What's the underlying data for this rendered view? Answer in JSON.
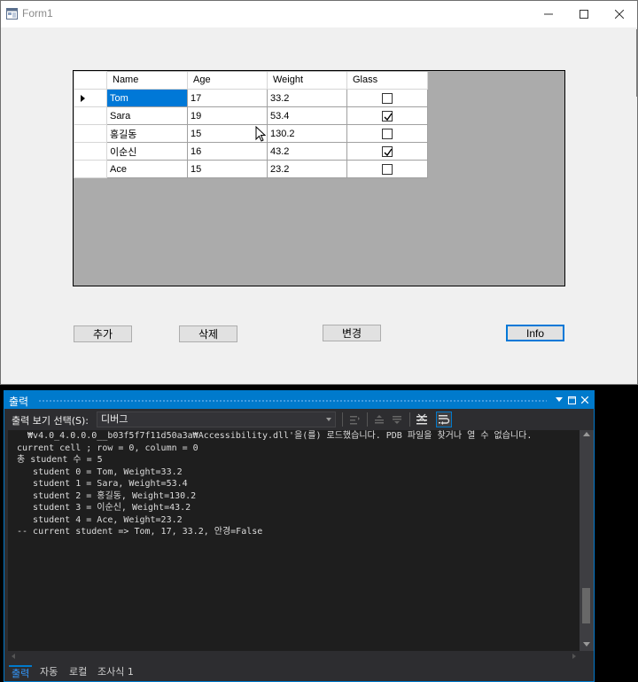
{
  "form": {
    "title": "Form1",
    "columns": [
      "Name",
      "Age",
      "Weight",
      "Glass"
    ],
    "rows": [
      {
        "name": "Tom",
        "age": "17",
        "weight": "33.2",
        "glass": false
      },
      {
        "name": "Sara",
        "age": "19",
        "weight": "53.4",
        "glass": true
      },
      {
        "name": "홍길동",
        "age": "15",
        "weight": "130.2",
        "glass": false
      },
      {
        "name": "이순신",
        "age": "16",
        "weight": "43.2",
        "glass": true
      },
      {
        "name": "Ace",
        "age": "15",
        "weight": "23.2",
        "glass": false
      }
    ],
    "buttons": {
      "add": "추가",
      "delete": "삭제",
      "change": "변경",
      "info": "Info"
    }
  },
  "output": {
    "title": "출력",
    "show_output_from_label": "출력 보기 선택(S):",
    "show_output_from_value": "디버그",
    "lines": [
      "  ₩v4.0_4.0.0.0__b03f5f7f11d50a3a₩Accessibility.dll'을(를) 로드했습니다. PDB 파일을 찾거나 열 수 없습니다.",
      "current cell ; row = 0, column = 0",
      "총 student 수 = 5",
      "   student 0 = Tom, Weight=33.2",
      "   student 1 = Sara, Weight=53.4",
      "   student 2 = 홍길동, Weight=130.2",
      "   student 3 = 이순신, Weight=43.2",
      "   student 4 = Ace, Weight=23.2",
      "-- current student => Tom, 17, 33.2, 안경=False"
    ],
    "tabs": [
      "출력",
      "자동",
      "로컬",
      "조사식 1"
    ]
  }
}
